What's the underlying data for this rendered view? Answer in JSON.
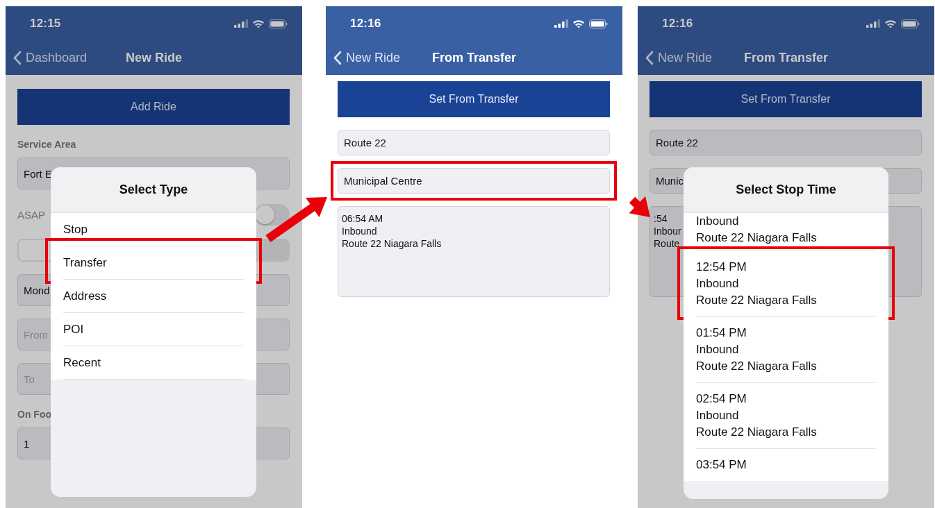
{
  "screens": [
    {
      "dimmed": true,
      "status_bar": {
        "time": "12:15"
      },
      "nav_bar": {
        "back_label": "Dashboard",
        "title": "New Ride"
      },
      "content": [
        {
          "kind": "button",
          "label": "Add Ride"
        },
        {
          "kind": "label",
          "text": "Service Area"
        },
        {
          "kind": "field",
          "value": "Fort E"
        },
        {
          "kind": "toggle",
          "label": "ASAP",
          "on": false
        },
        {
          "kind": "segmented"
        },
        {
          "kind": "field",
          "value": "Mond"
        },
        {
          "kind": "field",
          "placeholder": "From"
        },
        {
          "kind": "field",
          "placeholder": "To"
        },
        {
          "kind": "label",
          "text": "On Foo"
        },
        {
          "kind": "field",
          "value": "1"
        }
      ],
      "dialog": {
        "title": "Select Type",
        "items": [
          {
            "lines": [
              "Stop"
            ],
            "highlighted": false
          },
          {
            "lines": [
              "Transfer"
            ],
            "highlighted": true
          },
          {
            "lines": [
              "Address"
            ],
            "highlighted": false
          },
          {
            "lines": [
              "POI"
            ],
            "highlighted": false
          },
          {
            "lines": [
              "Recent"
            ],
            "highlighted": false
          }
        ]
      }
    },
    {
      "dimmed": false,
      "status_bar": {
        "time": "12:16"
      },
      "nav_bar": {
        "back_label": "New Ride",
        "title": "From Transfer"
      },
      "content": [
        {
          "kind": "button",
          "label": "Set From Transfer"
        },
        {
          "kind": "field",
          "value": "Route 22",
          "highlighted": false
        },
        {
          "kind": "field",
          "value": "Municipal Centre",
          "highlighted": true
        },
        {
          "kind": "textarea",
          "lines": [
            "06:54 AM",
            "Inbound",
            "Route 22 Niagara Falls"
          ]
        }
      ]
    },
    {
      "dimmed": true,
      "status_bar": {
        "time": "12:16"
      },
      "nav_bar": {
        "back_label": "New Ride",
        "title": "From Transfer"
      },
      "content": [
        {
          "kind": "button",
          "label": "Set From Transfer"
        },
        {
          "kind": "field",
          "value": "Route 22"
        },
        {
          "kind": "field",
          "value": "Munic"
        },
        {
          "kind": "textarea",
          "lines": [
            ":54",
            "Inbour",
            "Route"
          ]
        }
      ],
      "dialog": {
        "title": "Select Stop Time",
        "items": [
          {
            "lines": [
              "Inbound",
              "Route 22 Niagara Falls"
            ],
            "highlighted": false
          },
          {
            "lines": [
              "12:54 PM",
              "Inbound",
              "Route 22 Niagara Falls"
            ],
            "highlighted": true
          },
          {
            "lines": [
              "01:54 PM",
              "Inbound",
              "Route 22 Niagara Falls"
            ],
            "highlighted": false
          },
          {
            "lines": [
              "02:54 PM",
              "Inbound",
              "Route 22 Niagara Falls"
            ],
            "highlighted": false
          },
          {
            "lines": [
              "03:54 PM"
            ],
            "highlighted": false
          }
        ]
      }
    }
  ]
}
